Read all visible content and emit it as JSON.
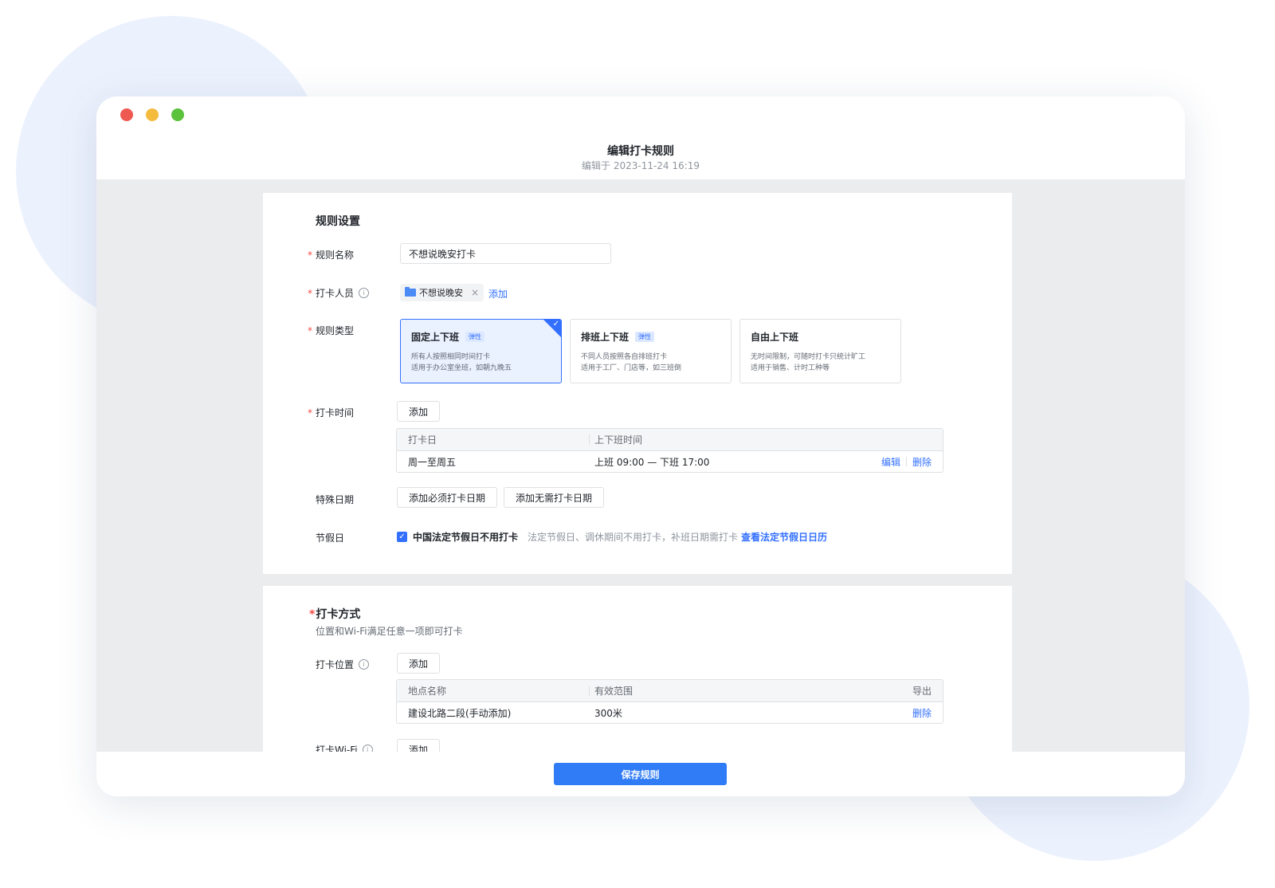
{
  "header": {
    "title": "编辑打卡规则",
    "subtitle": "编辑于 2023-11-24 16:19"
  },
  "rules": {
    "section_title": "规则设置",
    "required_mark": "*",
    "info_glyph": "i",
    "name": {
      "label": "规则名称",
      "value": "不想说晚安打卡"
    },
    "members": {
      "label": "打卡人员",
      "chips": [
        {
          "name": "不想说晚安"
        }
      ],
      "close_glyph": "×",
      "add_link": "添加"
    },
    "type": {
      "label": "规则类型",
      "check_glyph": "✓",
      "options": [
        {
          "title": "固定上下班",
          "badge": "弹性",
          "line1": "所有人按照相同时间打卡",
          "line2": "适用于办公室坐班，如朝九晚五",
          "selected": true
        },
        {
          "title": "排班上下班",
          "badge": "弹性",
          "line1": "不同人员按照各自排班打卡",
          "line2": "适用于工厂、门店等，如三班倒",
          "selected": false
        },
        {
          "title": "自由上下班",
          "badge": "",
          "line1": "无时间限制，可随时打卡只统计旷工",
          "line2": "适用于销售、计时工种等",
          "selected": false
        }
      ]
    },
    "time": {
      "label": "打卡时间",
      "add_button": "添加",
      "table": {
        "headers": [
          "打卡日",
          "上下班时间"
        ],
        "rows": [
          {
            "day": "周一至周五",
            "time": "上班 09:00 — 下班 17:00"
          }
        ],
        "edit_action": "编辑",
        "delete_action": "删除"
      }
    },
    "special": {
      "label": "特殊日期",
      "add_required_button": "添加必须打卡日期",
      "add_exempt_button": "添加无需打卡日期"
    },
    "holiday": {
      "label": "节假日",
      "checked": true,
      "check_glyph": "✓",
      "checkbox_label": "中国法定节假日不用打卡",
      "note": "法定节假日、调休期间不用打卡，补班日期需打卡",
      "link": "查看法定节假日日历"
    }
  },
  "method": {
    "section_title": "打卡方式",
    "description": "位置和Wi-Fi满足任意一项即可打卡",
    "location": {
      "label": "打卡位置",
      "add_button": "添加",
      "table": {
        "headers": [
          "地点名称",
          "有效范围"
        ],
        "export_action": "导出",
        "rows": [
          {
            "name": "建设北路二段(手动添加)",
            "range": "300米"
          }
        ],
        "delete_action": "删除"
      }
    },
    "wifi": {
      "label": "打卡Wi-Fi",
      "add_button": "添加"
    }
  },
  "footer": {
    "save_button": "保存规则"
  },
  "colors": {
    "accent": "#3370ff",
    "save_button": "#2f7cf6",
    "required": "#f54a45",
    "window_red": "#ee5a52",
    "window_yellow": "#f4bb3f",
    "window_green": "#5bc23c"
  }
}
